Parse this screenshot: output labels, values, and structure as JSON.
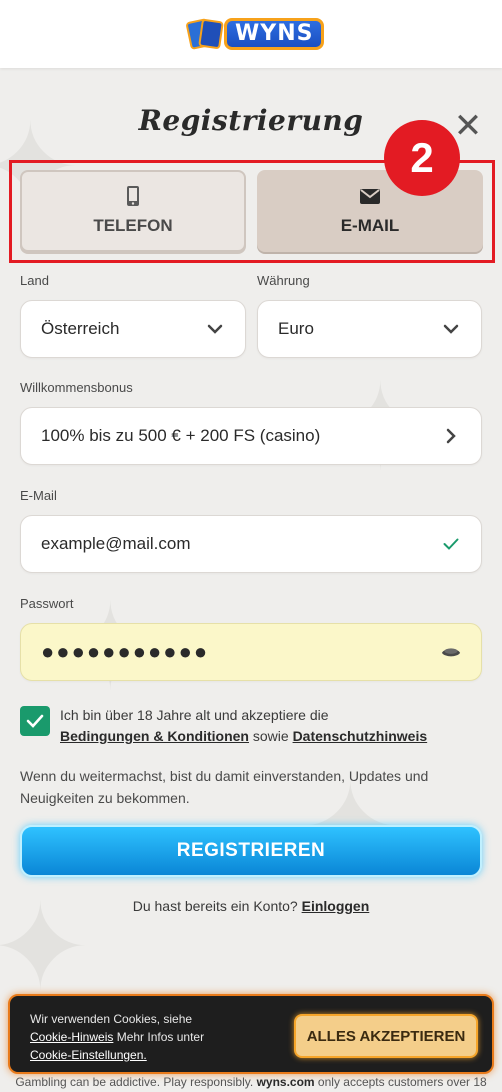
{
  "brand": {
    "logo_text": "WYNS"
  },
  "dialog": {
    "title": "Registrierung",
    "close_symbol": "✕",
    "step_badge": "2"
  },
  "tabs": [
    {
      "label": "TELEFON",
      "icon": "phone-icon"
    },
    {
      "label": "E-MAIL",
      "icon": "envelope-icon"
    }
  ],
  "form": {
    "country": {
      "label": "Land",
      "value": "Österreich"
    },
    "currency": {
      "label": "Währung",
      "value": "Euro"
    },
    "bonus": {
      "label": "Willkommensbonus",
      "value": "100% bis zu 500 € + 200 FS (casino)"
    },
    "email": {
      "label": "E-Mail",
      "value": "example@mail.com"
    },
    "password": {
      "label": "Passwort",
      "value": "●●●●●●●●●●●"
    }
  },
  "consent": {
    "checked": true,
    "text_before": "Ich bin über 18 Jahre alt und akzeptiere die",
    "terms_link": "Bedingungen & Konditionen",
    "middle": " sowie ",
    "privacy_link": "Datenschutzhinweis"
  },
  "info_text": "Wenn du weitermachst, bist du damit einverstanden, Updates und Neuigkeiten zu bekommen.",
  "register_label": "REGISTRIEREN",
  "login": {
    "prompt": "Du hast bereits ein Konto? ",
    "link": "Einloggen"
  },
  "cookie": {
    "text1": "Wir verwenden Cookies, siehe",
    "link1": "Cookie-Hinweis",
    "text2": " Mehr Infos unter",
    "link2": "Cookie-Einstellungen.",
    "accept_label": "ALLES AKZEPTIEREN"
  },
  "footer": {
    "text1": "Gambling can be addictive. Play responsibly. ",
    "site": "wyns.com",
    "text2": " only accepts customers over 18"
  },
  "colors": {
    "accent_red": "#e31b23",
    "register_blue": "#0a86d6",
    "checkbox_green": "#1a9a6c",
    "cookie_orange": "#e87a1a"
  }
}
